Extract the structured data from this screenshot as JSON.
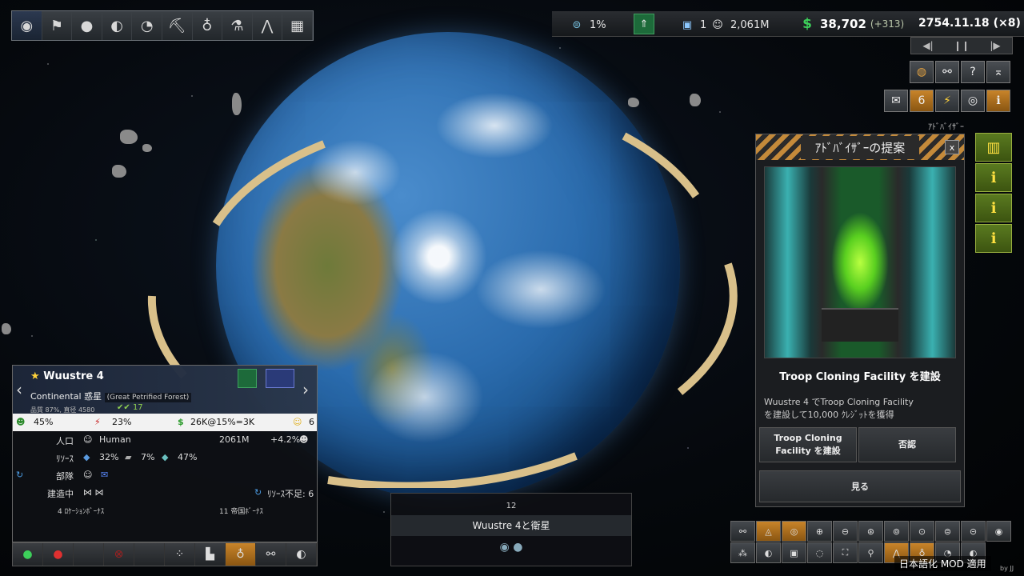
{
  "top_bar": {
    "research_pct": "1%",
    "empire_planets": "1",
    "population": "2,061M",
    "money": "38,702",
    "money_delta": "(+313)",
    "date": "2754.11.18",
    "speed": "(×8)"
  },
  "toolbar": {
    "icons": [
      "empire-icon",
      "flags-icon",
      "person-icon",
      "planet-icon",
      "gauge-icon",
      "pickaxe-icon",
      "bulb-icon",
      "flask-icon",
      "ships-icon",
      "settings-icon"
    ]
  },
  "top_right": {
    "alert_count": "6",
    "advisor_tag": "ｱﾄﾞﾊﾞｲｻﾞｰ"
  },
  "advisor": {
    "title": "ｱﾄﾞﾊﾞｲｻﾞｰの提案",
    "close": "x",
    "subject": "Troop Cloning Facility を建設",
    "description_line1": "Wuustre 4 でTroop Cloning Facility",
    "description_line2": "を建設して10,000 ｸﾚｼﾞｯﾄを獲得",
    "accept_line1": "Troop Cloning",
    "accept_line2": "Facility を建設",
    "reject": "否認",
    "view": "見る"
  },
  "planet": {
    "name": "Wuustre 4",
    "class": "Continental 惑星",
    "feature": "(Great Petrified Forest)",
    "quality": "品質 87%, 直径 4580",
    "happiness_count": "17",
    "stats": {
      "approval": "45%",
      "tax": "23%",
      "income": "26K@15%=3K",
      "happy": "6"
    },
    "population_label": "人口",
    "race": "Human",
    "population": "2061M",
    "growth": "+4.2%",
    "resources_label": "ﾘｿｰｽ",
    "resource1": "32%",
    "resource2": "7%",
    "resource3": "47%",
    "troops_label": "部隊",
    "construction_label": "建造中",
    "resource_shortage": "ﾘｿｰｽ不足: 6",
    "location_bonus": "4 ﾛｹｰｼｮﾝﾎﾞｰﾅｽ",
    "empire_bonus": "11 帝国ﾎﾞｰﾅｽ"
  },
  "system": {
    "count": "12",
    "name": "Wuustre 4と衛星"
  },
  "footer": {
    "localization_note": "日本語化 MOD 適用",
    "byline": "by JJ"
  }
}
